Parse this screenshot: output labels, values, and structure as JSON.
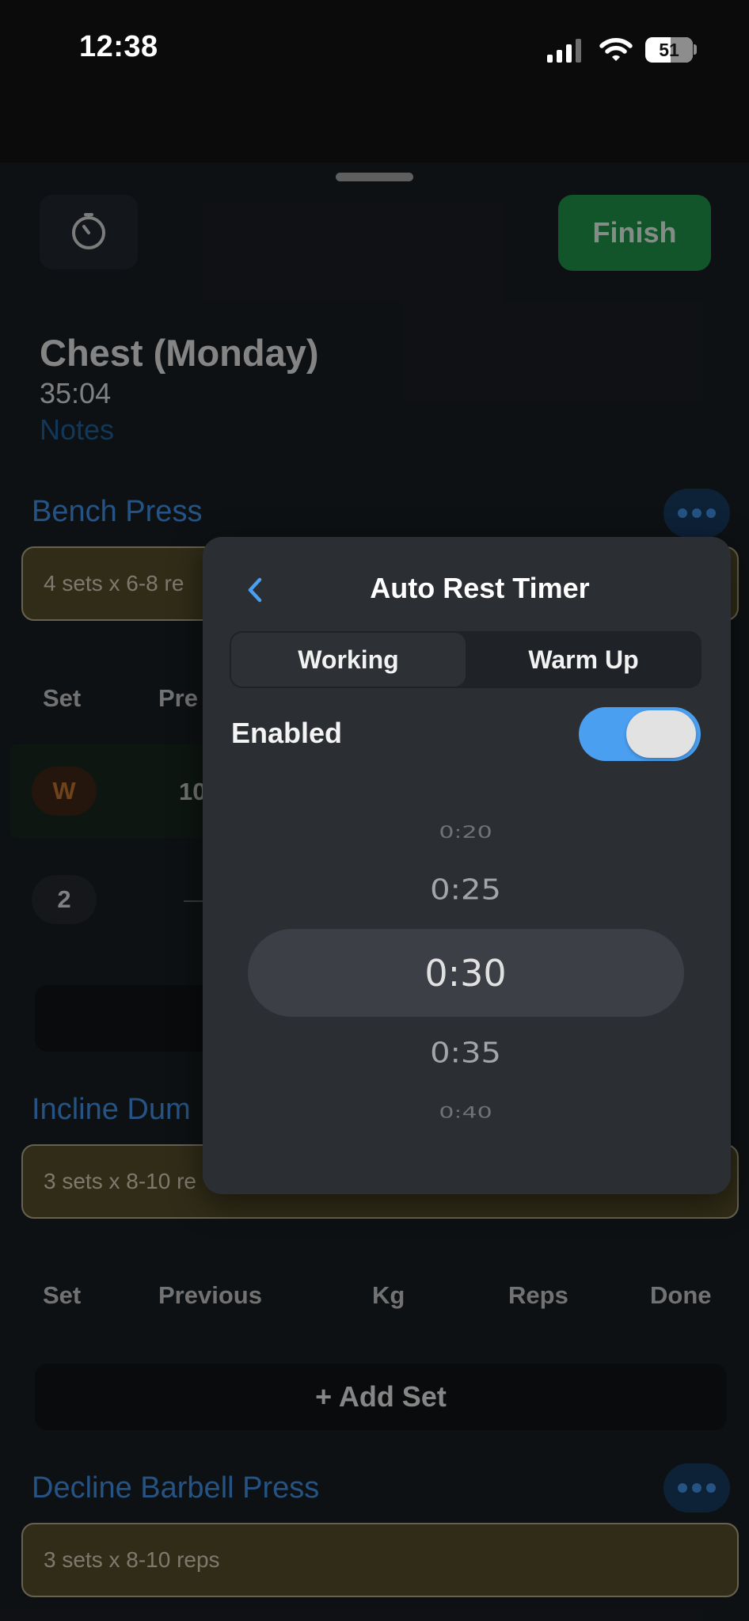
{
  "status_bar": {
    "time": "12:38",
    "battery": "51"
  },
  "header": {
    "finish_label": "Finish"
  },
  "workout": {
    "title": "Chest (Monday)",
    "elapsed": "35:04",
    "notes_placeholder": "Notes"
  },
  "exercises": [
    {
      "name": "Bench Press",
      "note": "4 sets x 6-8 re",
      "columns": [
        "Set",
        "Pre"
      ],
      "sets": [
        {
          "badge": "W",
          "previous": "10"
        },
        {
          "badge": "2",
          "previous": "—"
        }
      ]
    },
    {
      "name": "Incline Dum",
      "note": "3 sets x 8-10 re",
      "columns": [
        "Set",
        "Previous",
        "Kg",
        "Reps",
        "Done"
      ],
      "add_set_label": "+ Add Set"
    },
    {
      "name": "Decline Barbell Press",
      "note": "3 sets x 8-10 reps"
    }
  ],
  "popup": {
    "title": "Auto Rest Timer",
    "segments": [
      "Working",
      "Warm Up"
    ],
    "selected_segment": "Working",
    "enabled_label": "Enabled",
    "enabled": true,
    "picker": {
      "options": [
        "0:20",
        "0:25",
        "0:30",
        "0:35",
        "0:40"
      ],
      "selected": "0:30"
    }
  },
  "colors": {
    "accent": "#3b86d6",
    "finish_green": "#1d8a45",
    "toggle_on": "#4b9ff0",
    "note_bg": "#4e4828",
    "popup_bg": "#2b2e33"
  },
  "icons": {
    "timer": "stopwatch-icon",
    "back": "chevron-left-icon",
    "more": "ellipsis-icon",
    "wifi": "wifi-icon",
    "signal": "cellular-signal-icon",
    "battery": "battery-icon"
  }
}
